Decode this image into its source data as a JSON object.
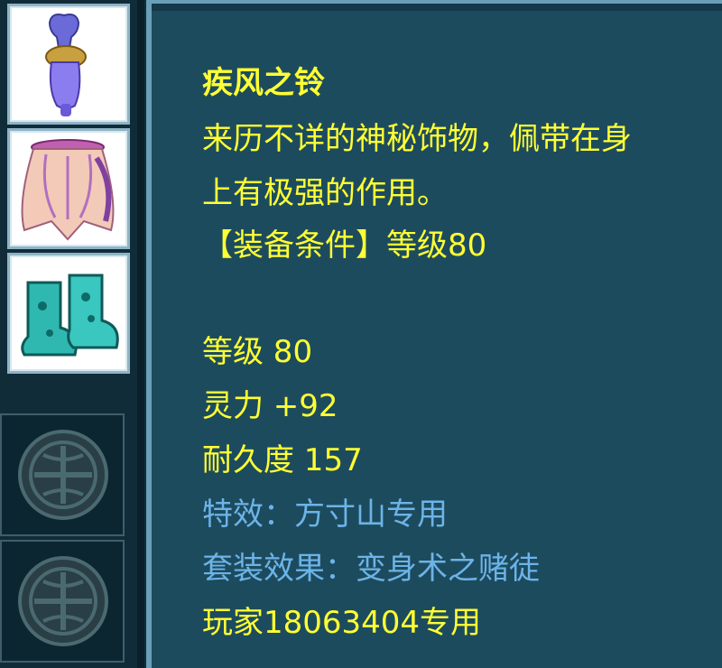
{
  "item": {
    "name": "疾风之铃",
    "desc_line1": "来历不详的神秘饰物，佩带在身",
    "desc_line2": "上有极强的作用。",
    "requirement": "【装备条件】等级80"
  },
  "stats": {
    "level": "等级 80",
    "spirit": "灵力 +92",
    "durability": "耐久度 157"
  },
  "special": {
    "effect": "特效：方寸山专用",
    "set_effect": "套装效果：变身术之赌徒"
  },
  "owner": "玩家18063404专用",
  "colors": {
    "panel_bg": "#1d4b5e",
    "text_yellow": "#ffff33",
    "text_blue": "#6cb4e8",
    "border": "#6aa0b7"
  },
  "slots": [
    {
      "icon": "bell-ornament-icon"
    },
    {
      "icon": "dress-armor-icon"
    },
    {
      "icon": "boots-icon"
    }
  ]
}
